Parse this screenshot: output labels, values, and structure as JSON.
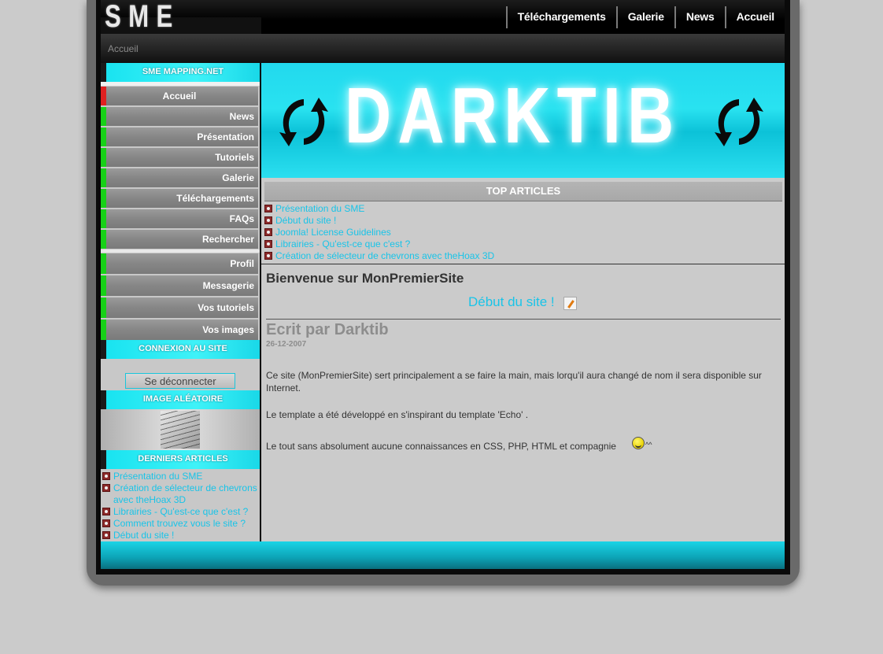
{
  "header": {
    "logo": "SME",
    "nav": [
      "Téléchargements",
      "Galerie",
      "News",
      "Accueil"
    ]
  },
  "breadcrumb": "Accueil",
  "sidebar": {
    "site_title": "SME MAPPING.NET",
    "menu": [
      "Accueil",
      "News",
      "Présentation",
      "Tutoriels",
      "Galerie",
      "Téléchargements",
      "FAQs",
      "Rechercher"
    ],
    "user_menu": [
      "Profil",
      "Messagerie",
      "Vos tutoriels",
      "Vos images"
    ],
    "login_title": "CONNEXION AU SITE",
    "logout_label": "Se déconnecter",
    "random_image_title": "IMAGE ALÉATOIRE",
    "latest_title": "DERNIERS ARTICLES",
    "latest_articles": [
      "Présentation du SME",
      "Création de sélecteur de chevrons avec theHoax 3D",
      "Librairies - Qu'est-ce que c'est ?",
      "Comment trouvez vous le site ?",
      "Début du site !"
    ]
  },
  "banner": {
    "text": "DARKTIB"
  },
  "top_articles": {
    "title": "TOP ARTICLES",
    "items": [
      "Présentation du SME",
      "Début du site !",
      "Joomla! License Guidelines",
      "Librairies - Qu'est-ce que c'est ?",
      "Création de sélecteur de chevrons avec theHoax 3D"
    ]
  },
  "article": {
    "welcome": "Bienvenue sur MonPremierSite",
    "title": "Début du site !",
    "author": "Ecrit par Darktib",
    "date": "26-12-2007",
    "para1": "Ce site (MonPremierSite) sert principalement a se faire la main, mais lorqu'il aura changé de nom il sera disponible sur Internet.",
    "para2": "Le template a été développé en s'inspirant du template 'Echo' .",
    "para3": "Le tout sans absolument aucune connaissances en CSS, PHP, HTML et compagnie",
    "smiley_suffix": "^^"
  },
  "colors": {
    "accent": "#19c4e8",
    "cyan": "#2be2f0",
    "active_bar": "#e02020",
    "item_bar": "#17d117"
  }
}
